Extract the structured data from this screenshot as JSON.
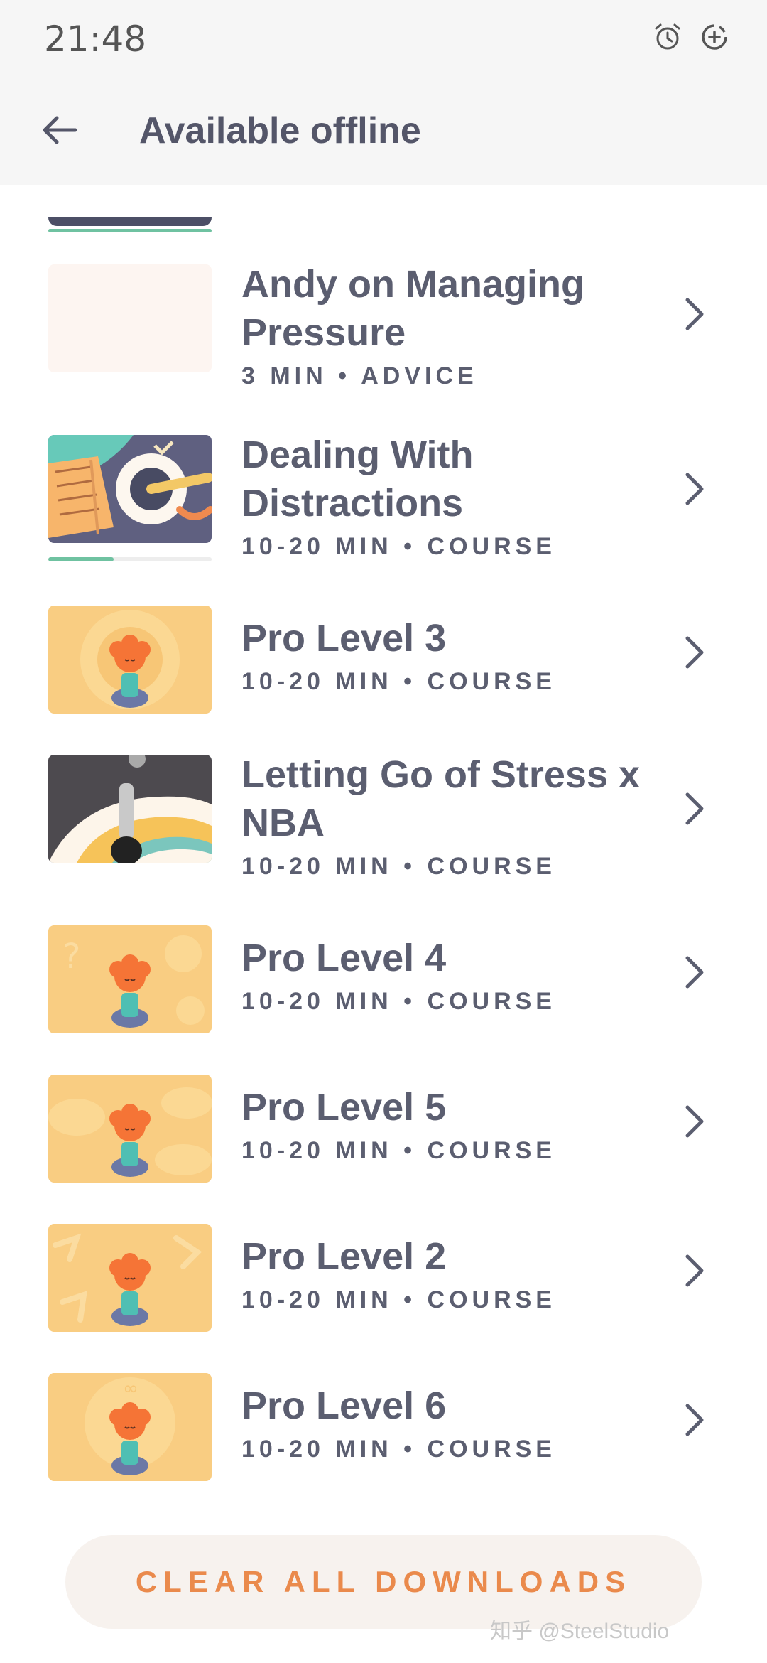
{
  "status_bar": {
    "time": "21:48",
    "icons": [
      "alarm-icon",
      "data-saver-icon"
    ]
  },
  "header": {
    "title": "Available offline",
    "back_icon": "arrow-left-icon"
  },
  "items": [
    {
      "title_lines": [
        "Andy on Managing",
        "Pressure"
      ],
      "meta": "3 MIN • ADVICE",
      "thumb": "blank-thumbnail"
    },
    {
      "title_lines": [
        "Dealing With",
        "Distractions"
      ],
      "meta": "10-20 MIN • COURSE",
      "thumb": "book-and-record-thumbnail",
      "progress": 0.4
    },
    {
      "title_lines": [
        "Pro Level 3"
      ],
      "meta": "10-20 MIN • COURSE",
      "thumb": "meditating-character-thumbnail"
    },
    {
      "title_lines": [
        "Letting Go of Stress x",
        "NBA"
      ],
      "meta": "10-20 MIN • COURSE",
      "thumb": "basketball-player-thumbnail"
    },
    {
      "title_lines": [
        "Pro Level 4"
      ],
      "meta": "10-20 MIN • COURSE",
      "thumb": "meditating-character-thumbnail"
    },
    {
      "title_lines": [
        "Pro Level 5"
      ],
      "meta": "10-20 MIN • COURSE",
      "thumb": "meditating-character-thumbnail"
    },
    {
      "title_lines": [
        "Pro Level 2"
      ],
      "meta": "10-20 MIN • COURSE",
      "thumb": "meditating-character-thumbnail"
    },
    {
      "title_lines": [
        "Pro Level 6"
      ],
      "meta": "10-20 MIN • COURSE",
      "thumb": "meditating-character-thumbnail"
    }
  ],
  "clear_button": {
    "label": "CLEAR ALL DOWNLOADS"
  },
  "watermark": "知乎 @SteelStudio",
  "colors": {
    "accent": "#ea8a4c",
    "text": "#5b5e70",
    "progress": "#6fc2a1",
    "header_bg": "#f6f6f6",
    "button_bg": "#f7f2ee"
  }
}
